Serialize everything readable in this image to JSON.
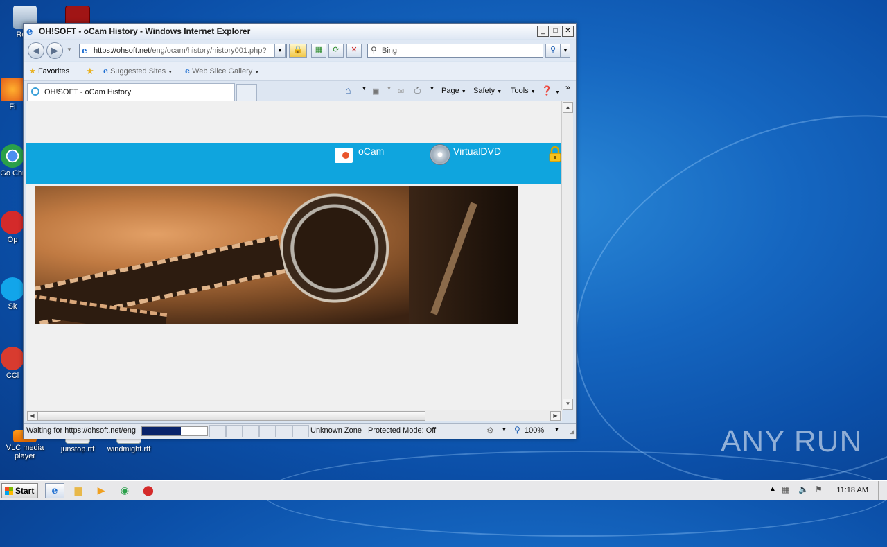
{
  "desktop": {
    "icons": [
      {
        "label": "Recy"
      },
      {
        "label": "Fi"
      },
      {
        "label": "Go Chr"
      },
      {
        "label": "Op"
      },
      {
        "label": "Sk"
      },
      {
        "label": "CCl"
      },
      {
        "label": "VLC media player"
      },
      {
        "label": "junstop.rtf"
      },
      {
        "label": "windmight.rtf"
      }
    ],
    "watermark": "ANY RUN"
  },
  "window": {
    "title": "OH!SOFT - oCam History - Windows Internet Explorer",
    "controls": {
      "minimize": "_",
      "maximize": "□",
      "close": "✕"
    }
  },
  "address": {
    "url_host": "https://ohsoft.net",
    "url_path": "/eng/ocam/history/history001.php?",
    "search_placeholder": "Bing"
  },
  "favorites": {
    "favorites_label": "Favorites",
    "suggested_label": "Suggested Sites",
    "webslice_label": "Web Slice Gallery"
  },
  "tabs": [
    {
      "label": "OH!SOFT - oCam History"
    }
  ],
  "commandbar": {
    "page": "Page",
    "safety": "Safety",
    "tools": "Tools"
  },
  "page": {
    "nav": [
      {
        "label": "oCam"
      },
      {
        "label": "VirtualDVD"
      }
    ]
  },
  "status": {
    "text": "Waiting for https://ohsoft.net/eng",
    "progress_fraction": 0.6,
    "zone": "Unknown Zone | Protected Mode: Off",
    "zoom": "100%"
  },
  "taskbar": {
    "start_label": "Start",
    "clock": "11:18 AM"
  }
}
